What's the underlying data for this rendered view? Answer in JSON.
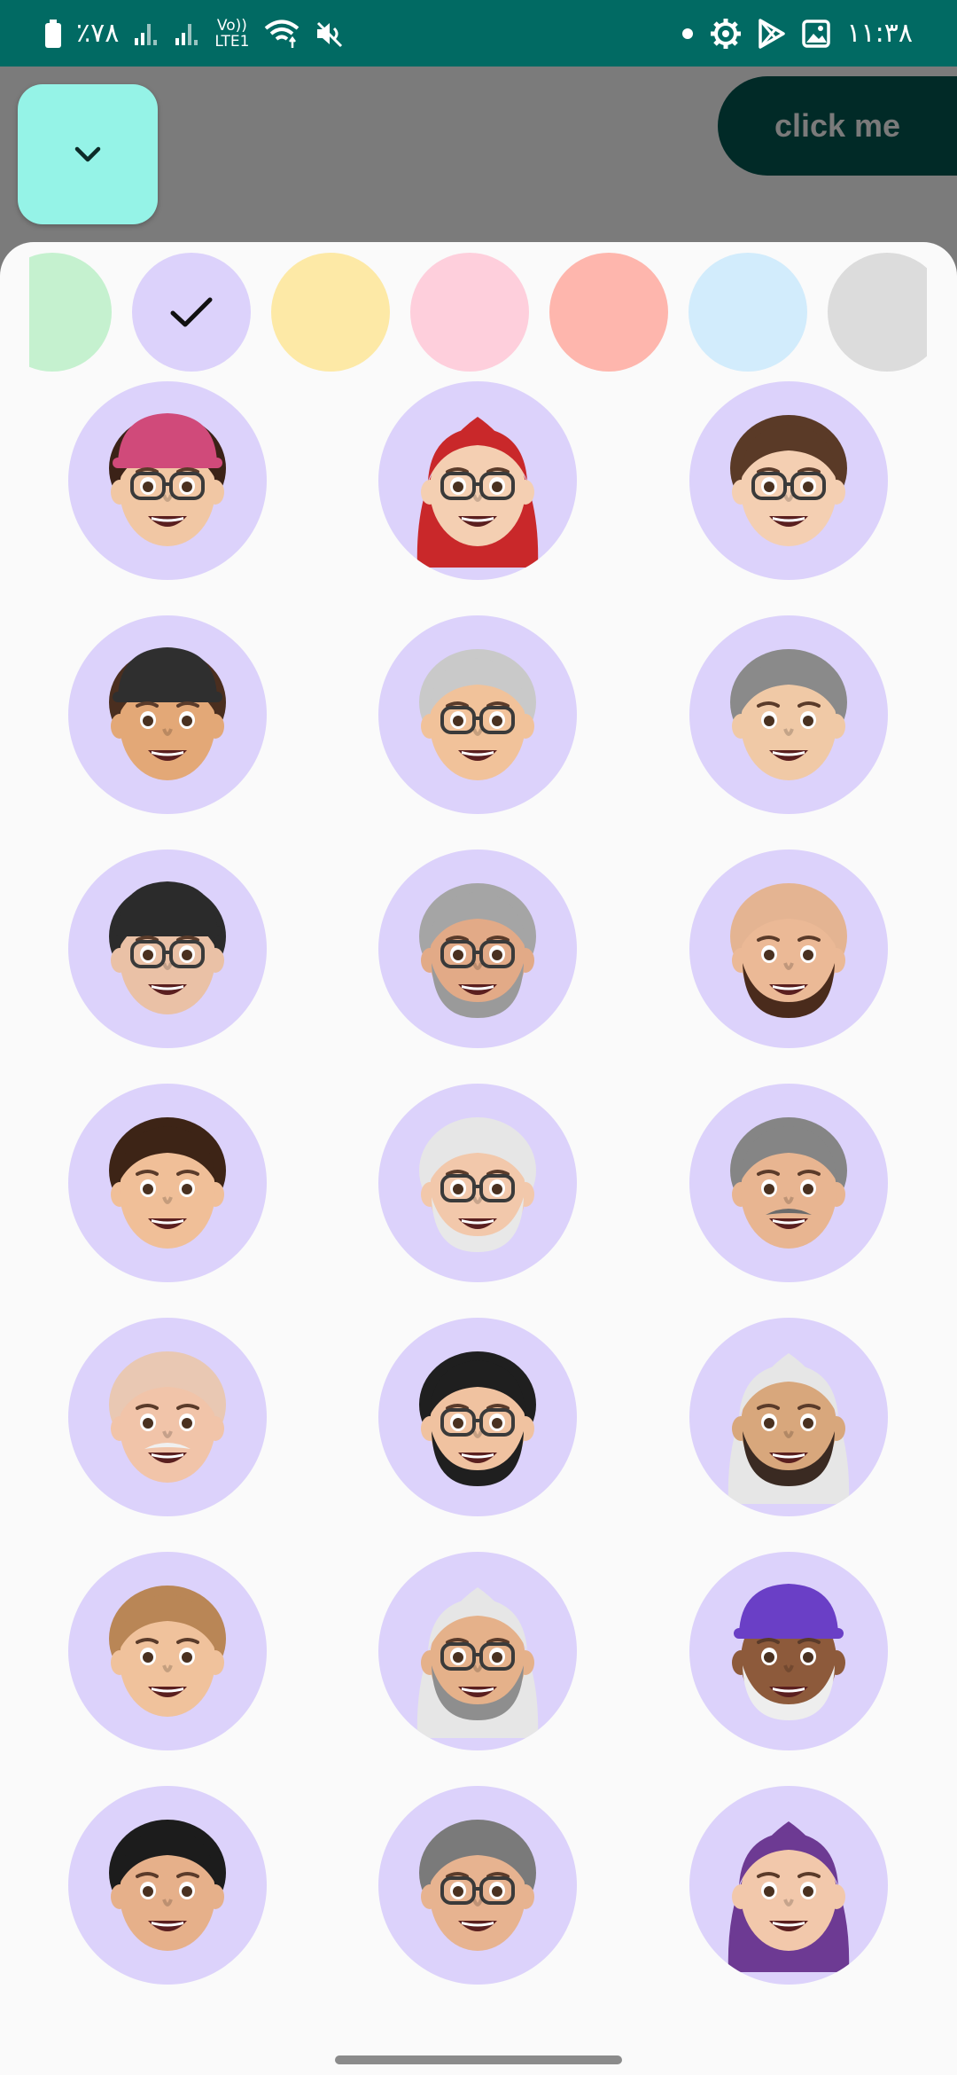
{
  "status_bar": {
    "battery_percent": "٪۷۸",
    "volte_line1": "Vo))",
    "volte_line2": "LTE1",
    "time": "۱۱:۳۸",
    "icons": [
      "battery-icon",
      "signal-icon",
      "signal-icon",
      "volte-icon",
      "wifi-icon",
      "mute-icon",
      "dot-icon",
      "settings-icon",
      "play-store-icon",
      "gallery-icon"
    ]
  },
  "top": {
    "dropdown_icon": "chevron-down-icon",
    "button_label": "click me"
  },
  "colors": {
    "selected_index": 1,
    "swatches": [
      "#c5f1cf",
      "#dcd2fb",
      "#fde9a6",
      "#fecfdc",
      "#feb6ad",
      "#d2ecfc",
      "#dcdcdc"
    ]
  },
  "avatars": {
    "circle_color": "#dcd2fb",
    "items": [
      {
        "hair": "#3b2217",
        "skin": "#f1c7a4",
        "hat": "#d04a7a",
        "glasses": true,
        "beard": null,
        "mustache": null,
        "headscarf": null
      },
      {
        "hair": null,
        "skin": "#f4cfb2",
        "hat": null,
        "glasses": true,
        "beard": null,
        "mustache": null,
        "headscarf": "#c9282a"
      },
      {
        "hair": "#5a3a27",
        "skin": "#f4cfb2",
        "hat": null,
        "glasses": true,
        "beard": null,
        "mustache": null,
        "headscarf": null
      },
      {
        "hair": "#4a2e1f",
        "skin": "#e3a877",
        "hat": "#2f2f2f",
        "glasses": false,
        "beard": null,
        "mustache": null,
        "headscarf": null
      },
      {
        "hair": "#c9c9c9",
        "skin": "#f1c29a",
        "hat": null,
        "glasses": true,
        "beard": null,
        "mustache": null,
        "headscarf": null
      },
      {
        "hair": "#8a8a8a",
        "skin": "#f0c9a6",
        "hat": null,
        "glasses": false,
        "beard": null,
        "mustache": null,
        "headscarf": null
      },
      {
        "hair": "#2b2b2b",
        "skin": "#eac1a6",
        "hat": "#2b2b2b",
        "glasses": true,
        "beard": null,
        "mustache": null,
        "headscarf": null
      },
      {
        "hair": "#a5a5a5",
        "skin": "#e2aa87",
        "hat": null,
        "glasses": true,
        "beard": "#9a9a9a",
        "mustache": null,
        "headscarf": null
      },
      {
        "hair": "#e4b492",
        "skin": "#ebb996",
        "hat": null,
        "glasses": false,
        "beard": "#4a2b1c",
        "mustache": null,
        "headscarf": null
      },
      {
        "hair": "#3d2416",
        "skin": "#f0bf98",
        "hat": null,
        "glasses": false,
        "beard": null,
        "mustache": null,
        "headscarf": null
      },
      {
        "hair": "#e6e6e6",
        "skin": "#f2c8ab",
        "hat": null,
        "glasses": true,
        "beard": "#e8e8e8",
        "mustache": null,
        "headscarf": null
      },
      {
        "hair": "#858585",
        "skin": "#e8b591",
        "hat": null,
        "glasses": false,
        "beard": null,
        "mustache": "#6b6b6b",
        "headscarf": null
      },
      {
        "hair": "#e9c8b3",
        "skin": "#f1c4a9",
        "hat": null,
        "glasses": false,
        "beard": null,
        "mustache": "#f0f0f0",
        "headscarf": null
      },
      {
        "hair": "#1f1f1f",
        "skin": "#f0c2a0",
        "hat": null,
        "glasses": true,
        "beard": "#1f1f1f",
        "mustache": null,
        "headscarf": null
      },
      {
        "hair": null,
        "skin": "#d8a77c",
        "hat": null,
        "glasses": false,
        "beard": "#3a2a22",
        "mustache": null,
        "headscarf": "#e6e6e6"
      },
      {
        "hair": "#b98656",
        "skin": "#f0c29c",
        "hat": null,
        "glasses": false,
        "beard": null,
        "mustache": null,
        "headscarf": null
      },
      {
        "hair": null,
        "skin": "#e5b18a",
        "hat": null,
        "glasses": true,
        "beard": "#8e8e8e",
        "mustache": null,
        "headscarf": "#e6e6e6"
      },
      {
        "hair": null,
        "skin": "#8d5a3b",
        "hat": "#6a3fc6",
        "glasses": false,
        "beard": "#eeeeee",
        "mustache": null,
        "headscarf": null
      },
      {
        "hair": "#1c1c1c",
        "skin": "#e6b08a",
        "hat": null,
        "glasses": false,
        "beard": null,
        "mustache": null,
        "headscarf": null
      },
      {
        "hair": "#7a7a7a",
        "skin": "#e7b390",
        "hat": null,
        "glasses": true,
        "beard": null,
        "mustache": null,
        "headscarf": null
      },
      {
        "hair": null,
        "skin": "#f2c8ab",
        "hat": null,
        "glasses": false,
        "beard": null,
        "mustache": null,
        "headscarf": "#6d3a93"
      }
    ]
  }
}
